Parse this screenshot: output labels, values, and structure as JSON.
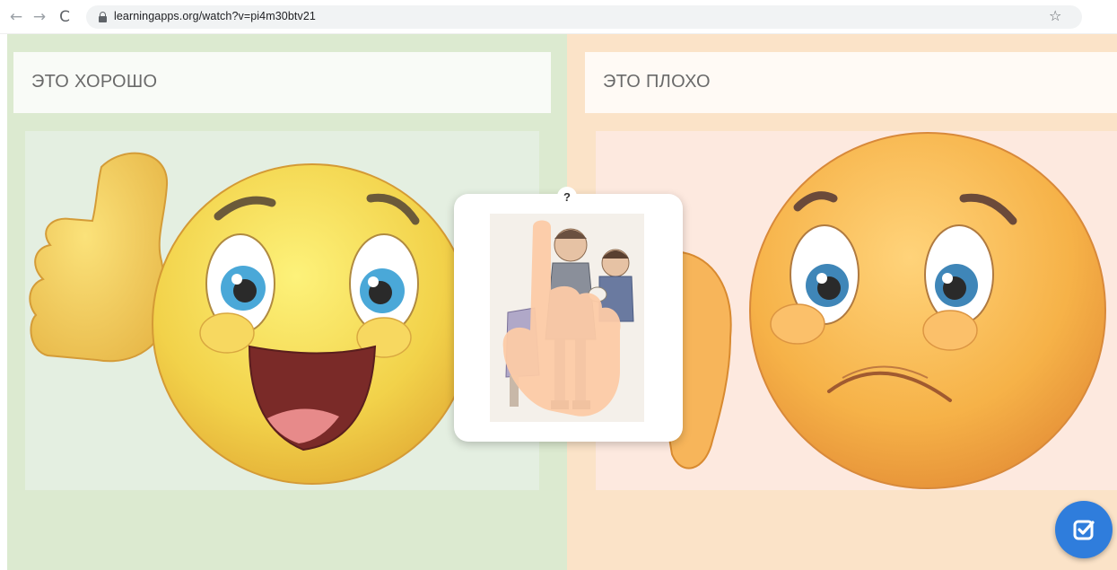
{
  "browser": {
    "url": "learningapps.org/watch?v=pi4m30btv21",
    "back_icon": "←",
    "forward_icon": "→",
    "reload_icon": "C",
    "star_icon": "☆"
  },
  "panels": [
    {
      "title": "ЭТО ХОРОШО",
      "color": "#dcead0"
    },
    {
      "title": "ЭТО ПЛОХО",
      "color": "#fbe3c8"
    }
  ],
  "card": {
    "badge": "?"
  },
  "colors": {
    "accent": "#2f7ddc"
  }
}
